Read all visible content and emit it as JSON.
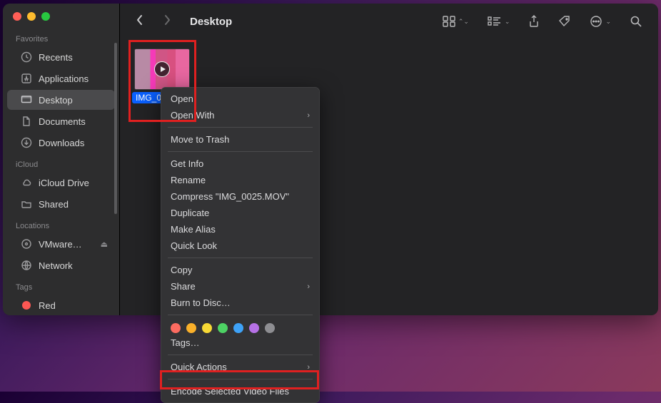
{
  "window": {
    "title": "Desktop"
  },
  "sidebar": {
    "sections": {
      "favorites": {
        "header": "Favorites",
        "items": [
          {
            "label": "Recents",
            "icon": "clock"
          },
          {
            "label": "Applications",
            "icon": "app"
          },
          {
            "label": "Desktop",
            "icon": "desktop",
            "active": true
          },
          {
            "label": "Documents",
            "icon": "doc"
          },
          {
            "label": "Downloads",
            "icon": "download"
          }
        ]
      },
      "icloud": {
        "header": "iCloud",
        "items": [
          {
            "label": "iCloud Drive",
            "icon": "cloud"
          },
          {
            "label": "Shared",
            "icon": "folder-shared"
          }
        ]
      },
      "locations": {
        "header": "Locations",
        "items": [
          {
            "label": "VMware…",
            "icon": "disk",
            "ejectable": true
          },
          {
            "label": "Network",
            "icon": "globe"
          }
        ]
      },
      "tags": {
        "header": "Tags",
        "items": [
          {
            "label": "Red",
            "icon": "tag-red"
          }
        ]
      }
    }
  },
  "toolbar": {
    "view": "icon-view",
    "group": "group-by"
  },
  "file": {
    "label": "IMG_0025.MOV"
  },
  "context_menu": {
    "open": "Open",
    "open_with": "Open With",
    "move_trash": "Move to Trash",
    "get_info": "Get Info",
    "rename": "Rename",
    "compress": "Compress \"IMG_0025.MOV\"",
    "duplicate": "Duplicate",
    "make_alias": "Make Alias",
    "quick_look": "Quick Look",
    "copy": "Copy",
    "share": "Share",
    "burn": "Burn to Disc…",
    "tag_colors": [
      "#fc6b60",
      "#f9b02a",
      "#f7d935",
      "#4dd264",
      "#3ea2f7",
      "#b671e6",
      "#8e8e92"
    ],
    "tags": "Tags…",
    "quick_actions": "Quick Actions",
    "encode": "Encode Selected Video Files"
  }
}
